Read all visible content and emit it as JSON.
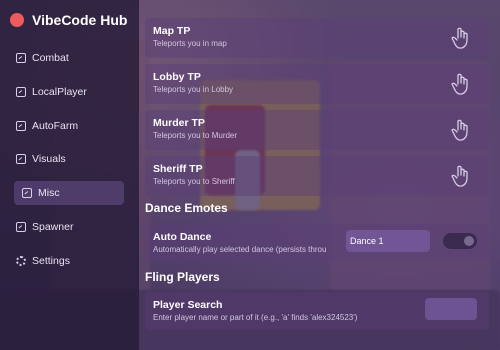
{
  "app": {
    "title": "VibeCode Hub",
    "brand_color": "#ee5b5e"
  },
  "sidebar": {
    "items": [
      {
        "label": "Combat",
        "icon": "window-icon"
      },
      {
        "label": "LocalPlayer",
        "icon": "window-icon"
      },
      {
        "label": "AutoFarm",
        "icon": "window-icon"
      },
      {
        "label": "Visuals",
        "icon": "window-icon"
      },
      {
        "label": "Misc",
        "icon": "window-icon",
        "active": true
      },
      {
        "label": "Spawner",
        "icon": "window-icon"
      },
      {
        "label": "Settings",
        "icon": "gear-icon"
      }
    ]
  },
  "teleports": [
    {
      "title": "Map TP",
      "subtitle": "Teleports you in map",
      "icon": "hand-pointer-icon"
    },
    {
      "title": "Lobby TP",
      "subtitle": "Teleports you in Lobby",
      "icon": "hand-pointer-icon"
    },
    {
      "title": "Murder TP",
      "subtitle": "Teleports you to Murder",
      "icon": "hand-pointer-icon"
    },
    {
      "title": "Sheriff TP",
      "subtitle": "Teleports you to Sheriff",
      "icon": "hand-pointer-icon"
    }
  ],
  "dance": {
    "section_title": "Dance Emotes",
    "title": "Auto Dance",
    "subtitle": "Automatically play selected dance (persists throu",
    "dropdown_value": "Dance 1",
    "toggle_on": false
  },
  "fling": {
    "section_title": "Fling Players",
    "title": "Player Search",
    "subtitle": "Enter player name or part of it (e.g., 'a' finds 'alex324523')",
    "input_value": ""
  }
}
